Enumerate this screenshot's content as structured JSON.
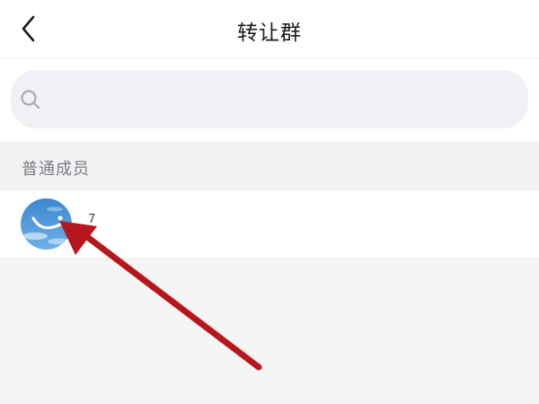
{
  "header": {
    "title": "转让群",
    "back_icon": "chevron-left-icon"
  },
  "search": {
    "placeholder": "",
    "value": "",
    "icon": "search-icon"
  },
  "section": {
    "title": "普通成员"
  },
  "members": [
    {
      "name": "7",
      "avatar": "sky-blue-avatar"
    }
  ],
  "colors": {
    "annotation_arrow": "#b5171d",
    "avatar_blue": "#4a93d6",
    "page_bg": "#f5f5f6",
    "search_bg": "#f0f1f5"
  }
}
